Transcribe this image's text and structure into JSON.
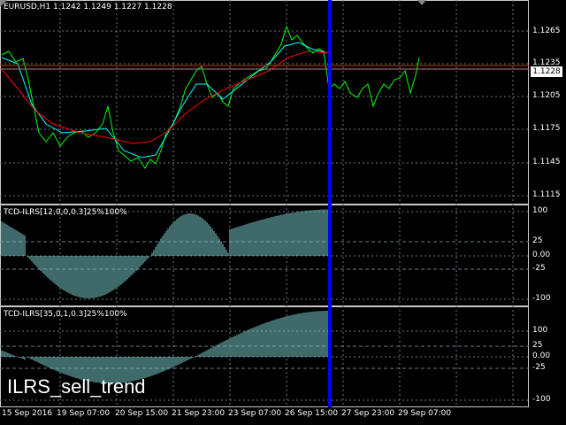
{
  "header": {
    "symbol": "EURUSD,H1",
    "ohlc": "1.1242 1.1249 1.1227 1.1228"
  },
  "price_scale": {
    "labels": [
      "1.1265",
      "1.1235",
      "1.1205",
      "1.1175",
      "1.1145",
      "1.1115"
    ],
    "current_price": "1.1228"
  },
  "indicator1": {
    "title": "TCD-ILRS[12,0,0,0.3]25%100%",
    "levels": [
      "100",
      "25",
      "0.00",
      "-25",
      "-100"
    ]
  },
  "indicator2": {
    "title": "TCD-ILRS[35,0,1,0.3]25%100%",
    "levels": [
      "100",
      "25",
      "0.00",
      "-25",
      "-100"
    ]
  },
  "time_axis": {
    "labels": [
      "15 Sep 2016",
      "19 Sep 07:00",
      "20 Sep 15:00",
      "21 Sep 23:00",
      "23 Sep 07:00",
      "26 Sep 15:00",
      "27 Sep 23:00",
      "29 Sep 07:00"
    ]
  },
  "signal_label": "ILRS_sell_trend",
  "colors": {
    "price": "#00ff00",
    "fast_ma": "#00ffff",
    "slow_ma": "#ff0000",
    "histogram": "#7fd3d3",
    "signal_line": "#0000ff",
    "level_line": "#6c7a84"
  }
}
